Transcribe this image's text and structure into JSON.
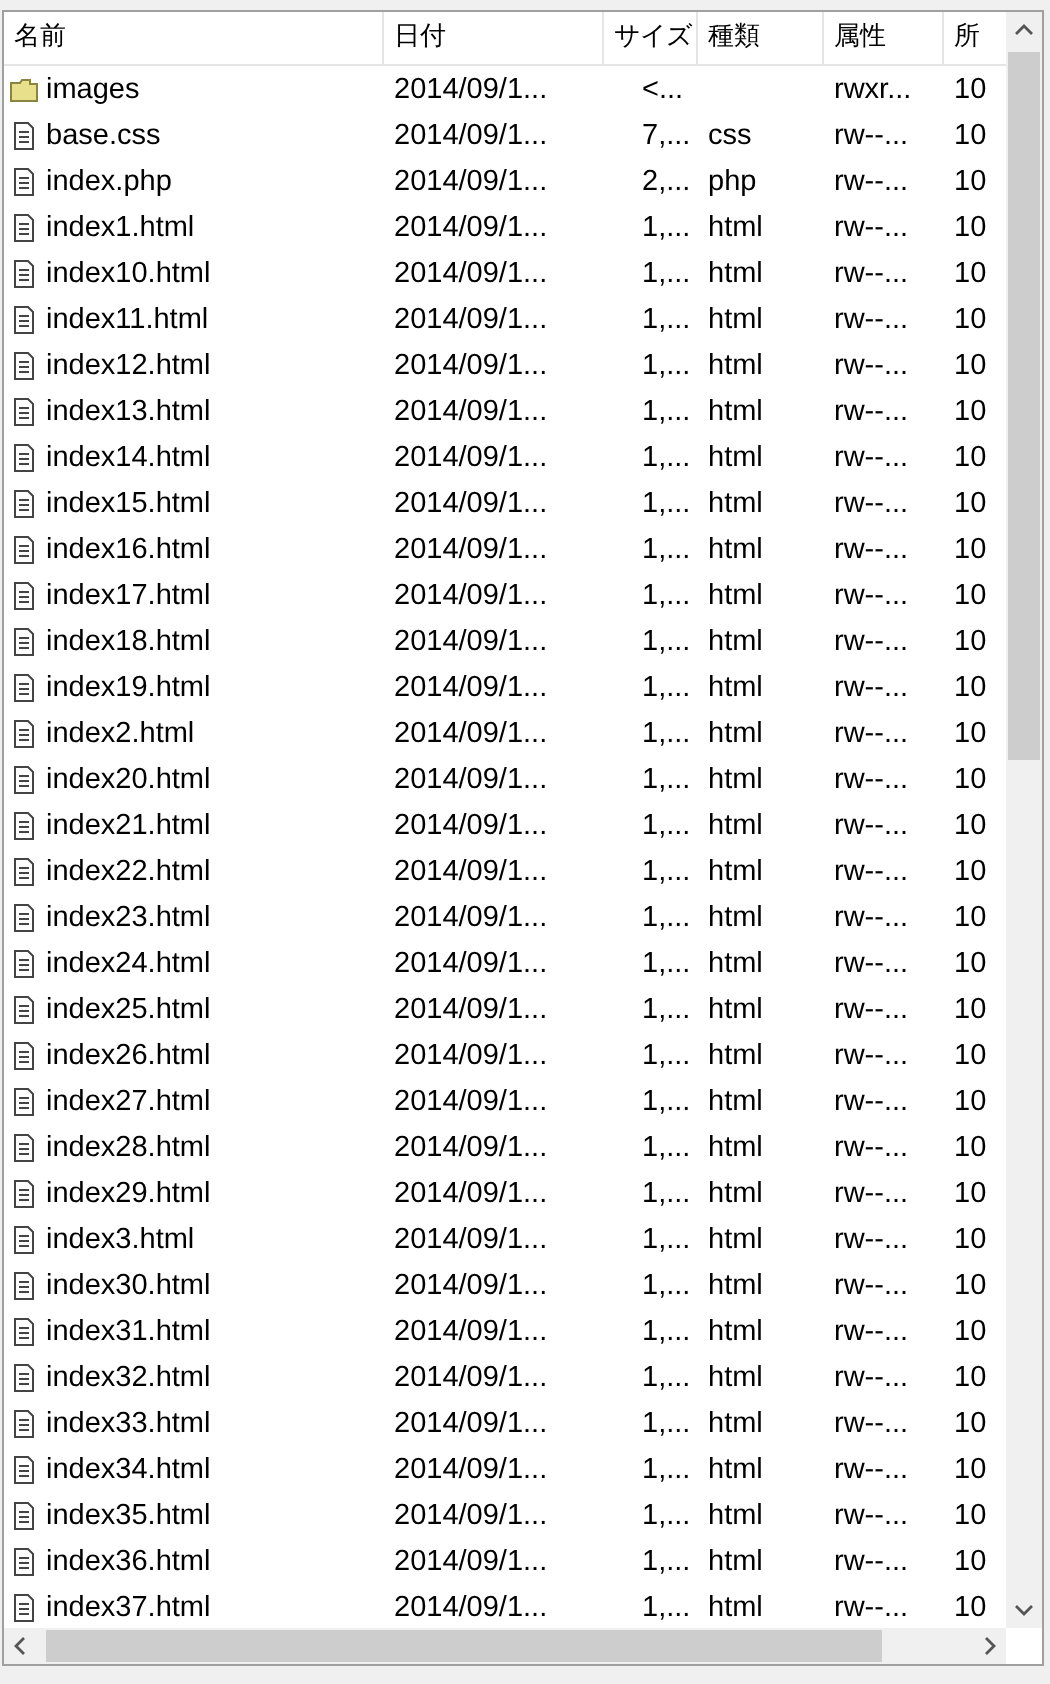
{
  "columns": {
    "name": "名前",
    "date": "日付",
    "size": "サイズ",
    "type": "種類",
    "attributes": "属性",
    "column_6": "所"
  },
  "files": [
    {
      "kind": "folder",
      "name": "images",
      "date": "2014/09/1...",
      "size": "<...",
      "attributes": "rwxr...",
      "column_6": "10"
    },
    {
      "kind": "file",
      "name": "base.css",
      "date": "2014/09/1...",
      "size": "7,...",
      "type": "css",
      "attributes": "rw--...",
      "column_6": "10"
    },
    {
      "kind": "file",
      "name": "index.php",
      "date": "2014/09/1...",
      "size": "2,...",
      "type": "php",
      "attributes": "rw--...",
      "column_6": "10"
    },
    {
      "kind": "file",
      "name": "index1.html",
      "date": "2014/09/1...",
      "size": "1,...",
      "type": "html",
      "attributes": "rw--...",
      "column_6": "10"
    },
    {
      "kind": "file",
      "name": "index10.html",
      "date": "2014/09/1...",
      "size": "1,...",
      "type": "html",
      "attributes": "rw--...",
      "column_6": "10"
    },
    {
      "kind": "file",
      "name": "index11.html",
      "date": "2014/09/1...",
      "size": "1,...",
      "type": "html",
      "attributes": "rw--...",
      "column_6": "10"
    },
    {
      "kind": "file",
      "name": "index12.html",
      "date": "2014/09/1...",
      "size": "1,...",
      "type": "html",
      "attributes": "rw--...",
      "column_6": "10"
    },
    {
      "kind": "file",
      "name": "index13.html",
      "date": "2014/09/1...",
      "size": "1,...",
      "type": "html",
      "attributes": "rw--...",
      "column_6": "10"
    },
    {
      "kind": "file",
      "name": "index14.html",
      "date": "2014/09/1...",
      "size": "1,...",
      "type": "html",
      "attributes": "rw--...",
      "column_6": "10"
    },
    {
      "kind": "file",
      "name": "index15.html",
      "date": "2014/09/1...",
      "size": "1,...",
      "type": "html",
      "attributes": "rw--...",
      "column_6": "10"
    },
    {
      "kind": "file",
      "name": "index16.html",
      "date": "2014/09/1...",
      "size": "1,...",
      "type": "html",
      "attributes": "rw--...",
      "column_6": "10"
    },
    {
      "kind": "file",
      "name": "index17.html",
      "date": "2014/09/1...",
      "size": "1,...",
      "type": "html",
      "attributes": "rw--...",
      "column_6": "10"
    },
    {
      "kind": "file",
      "name": "index18.html",
      "date": "2014/09/1...",
      "size": "1,...",
      "type": "html",
      "attributes": "rw--...",
      "column_6": "10"
    },
    {
      "kind": "file",
      "name": "index19.html",
      "date": "2014/09/1...",
      "size": "1,...",
      "type": "html",
      "attributes": "rw--...",
      "column_6": "10"
    },
    {
      "kind": "file",
      "name": "index2.html",
      "date": "2014/09/1...",
      "size": "1,...",
      "type": "html",
      "attributes": "rw--...",
      "column_6": "10"
    },
    {
      "kind": "file",
      "name": "index20.html",
      "date": "2014/09/1...",
      "size": "1,...",
      "type": "html",
      "attributes": "rw--...",
      "column_6": "10"
    },
    {
      "kind": "file",
      "name": "index21.html",
      "date": "2014/09/1...",
      "size": "1,...",
      "type": "html",
      "attributes": "rw--...",
      "column_6": "10"
    },
    {
      "kind": "file",
      "name": "index22.html",
      "date": "2014/09/1...",
      "size": "1,...",
      "type": "html",
      "attributes": "rw--...",
      "column_6": "10"
    },
    {
      "kind": "file",
      "name": "index23.html",
      "date": "2014/09/1...",
      "size": "1,...",
      "type": "html",
      "attributes": "rw--...",
      "column_6": "10"
    },
    {
      "kind": "file",
      "name": "index24.html",
      "date": "2014/09/1...",
      "size": "1,...",
      "type": "html",
      "attributes": "rw--...",
      "column_6": "10"
    },
    {
      "kind": "file",
      "name": "index25.html",
      "date": "2014/09/1...",
      "size": "1,...",
      "type": "html",
      "attributes": "rw--...",
      "column_6": "10"
    },
    {
      "kind": "file",
      "name": "index26.html",
      "date": "2014/09/1...",
      "size": "1,...",
      "type": "html",
      "attributes": "rw--...",
      "column_6": "10"
    },
    {
      "kind": "file",
      "name": "index27.html",
      "date": "2014/09/1...",
      "size": "1,...",
      "type": "html",
      "attributes": "rw--...",
      "column_6": "10"
    },
    {
      "kind": "file",
      "name": "index28.html",
      "date": "2014/09/1...",
      "size": "1,...",
      "type": "html",
      "attributes": "rw--...",
      "column_6": "10"
    },
    {
      "kind": "file",
      "name": "index29.html",
      "date": "2014/09/1...",
      "size": "1,...",
      "type": "html",
      "attributes": "rw--...",
      "column_6": "10"
    },
    {
      "kind": "file",
      "name": "index3.html",
      "date": "2014/09/1...",
      "size": "1,...",
      "type": "html",
      "attributes": "rw--...",
      "column_6": "10"
    },
    {
      "kind": "file",
      "name": "index30.html",
      "date": "2014/09/1...",
      "size": "1,...",
      "type": "html",
      "attributes": "rw--...",
      "column_6": "10"
    },
    {
      "kind": "file",
      "name": "index31.html",
      "date": "2014/09/1...",
      "size": "1,...",
      "type": "html",
      "attributes": "rw--...",
      "column_6": "10"
    },
    {
      "kind": "file",
      "name": "index32.html",
      "date": "2014/09/1...",
      "size": "1,...",
      "type": "html",
      "attributes": "rw--...",
      "column_6": "10"
    },
    {
      "kind": "file",
      "name": "index33.html",
      "date": "2014/09/1...",
      "size": "1,...",
      "type": "html",
      "attributes": "rw--...",
      "column_6": "10"
    },
    {
      "kind": "file",
      "name": "index34.html",
      "date": "2014/09/1...",
      "size": "1,...",
      "type": "html",
      "attributes": "rw--...",
      "column_6": "10"
    },
    {
      "kind": "file",
      "name": "index35.html",
      "date": "2014/09/1...",
      "size": "1,...",
      "type": "html",
      "attributes": "rw--...",
      "column_6": "10"
    },
    {
      "kind": "file",
      "name": "index36.html",
      "date": "2014/09/1...",
      "size": "1,...",
      "type": "html",
      "attributes": "rw--...",
      "column_6": "10"
    },
    {
      "kind": "file",
      "name": "index37.html",
      "date": "2014/09/1...",
      "size": "1,...",
      "type": "html",
      "attributes": "rw--...",
      "column_6": "10"
    }
  ]
}
